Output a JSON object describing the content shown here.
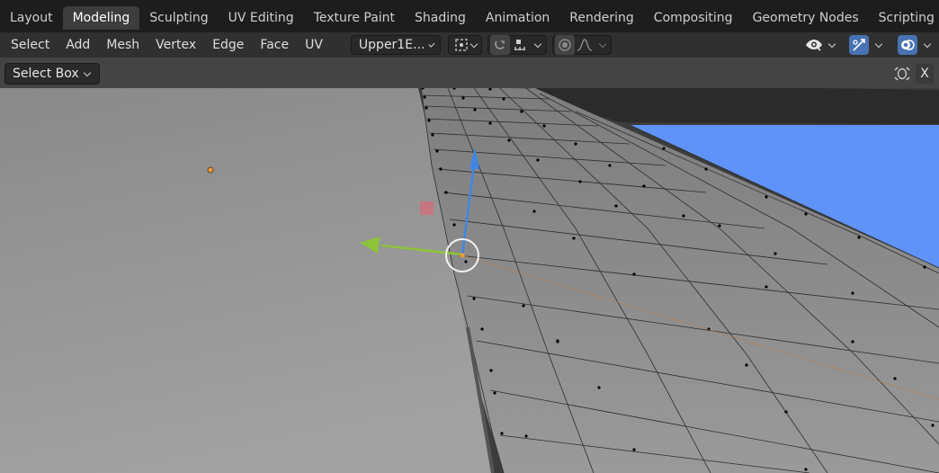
{
  "workspace_tabs": [
    {
      "label": "Layout",
      "active": false
    },
    {
      "label": "Modeling",
      "active": true
    },
    {
      "label": "Sculpting",
      "active": false
    },
    {
      "label": "UV Editing",
      "active": false
    },
    {
      "label": "Texture Paint",
      "active": false
    },
    {
      "label": "Shading",
      "active": false
    },
    {
      "label": "Animation",
      "active": false
    },
    {
      "label": "Rendering",
      "active": false
    },
    {
      "label": "Compositing",
      "active": false
    },
    {
      "label": "Geometry Nodes",
      "active": false
    },
    {
      "label": "Scripting",
      "active": false
    }
  ],
  "add_workspace_icon": "plus-icon",
  "header_menu": [
    "Select",
    "Add",
    "Mesh",
    "Vertex",
    "Edge",
    "Face",
    "UV"
  ],
  "header": {
    "object_dropdown": "Upper1E...",
    "pivot_icon": "pivot-point-icon",
    "snap_icon": "snap-magnet-icon",
    "snap_target_icon": "snap-increment-icon",
    "proportional_icon": "proportional-edit-icon",
    "falloff_icon": "falloff-curve-icon",
    "visibility_icon": "eye-icon",
    "gizmo_icon": "gizmo-icon",
    "overlay_icon": "overlay-icon"
  },
  "viewport": {
    "select_tool_label": "Select Box",
    "close_label": "X",
    "gizmo_toggle_icon": "transform-gizmo-icon"
  },
  "colors": {
    "active_tab": "#3d3d3d",
    "header_bg": "#303030",
    "highlight": "#4772b3",
    "sky": "#5f93f8",
    "axis_y_green": "#8cc43a",
    "axis_z_blue": "#3f86e4",
    "origin_orange": "#f29b38"
  }
}
